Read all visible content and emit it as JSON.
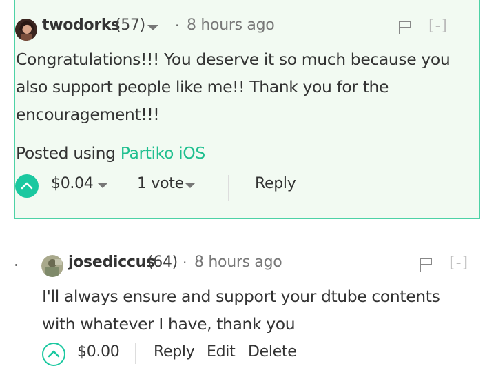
{
  "comment1": {
    "author": "twodorks",
    "reputation": "(57)",
    "separator": "·",
    "time": "8 hours ago",
    "collapse_label": "[-]",
    "body": "Congratulations!!! You deserve it so much because you also support people like me!! Thank you for the encouragement!!!",
    "posted_prefix": "Posted using ",
    "posted_link": "Partiko iOS",
    "payout": "$0.04",
    "votes": "1 vote",
    "reply_label": "Reply"
  },
  "comment2": {
    "author": "josediccus",
    "reputation": "(64)",
    "separator": "·",
    "time": "8 hours ago",
    "collapse_label": "[-]",
    "body": "I'll always ensure and support your dtube contents with whatever I have, thank you",
    "payout": "$0.00",
    "reply_label": "Reply",
    "edit_label": "Edit",
    "delete_label": "Delete"
  },
  "colors": {
    "accent": "#1bc8a0",
    "highlight_bg": "#f2faf2",
    "highlight_border": "#4ed2a6"
  }
}
